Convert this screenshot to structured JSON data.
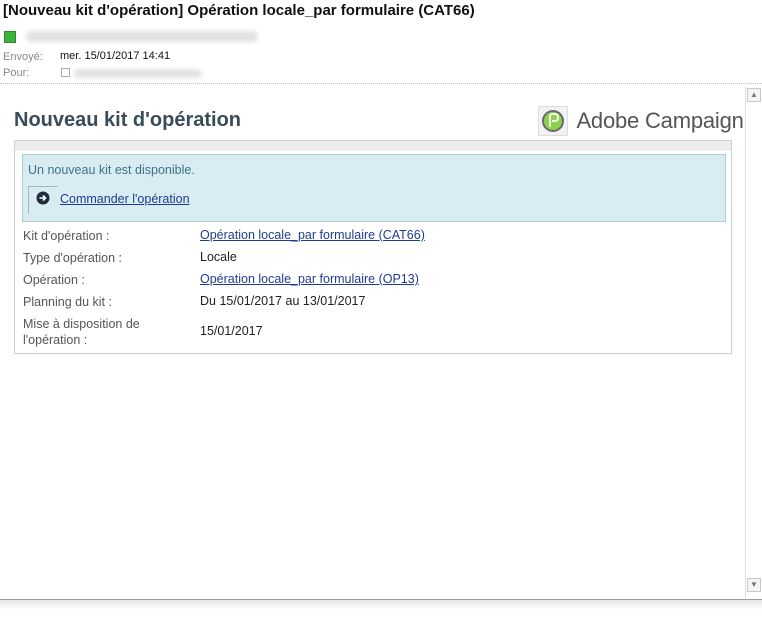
{
  "email": {
    "subject": "[Nouveau kit d'opération] Opération locale_par formulaire  (CAT66)",
    "sent_label": "Envoyé:",
    "sent_value": "mer. 15/01/2017 14:41",
    "to_label": "Pour:"
  },
  "content": {
    "title": "Nouveau kit d'opération",
    "logo_text": "Adobe Campaign",
    "notice": "Un nouveau kit est disponible.",
    "order_link": "Commander l'opération",
    "rows": [
      {
        "label": "Kit d'opération :",
        "value": "Opération locale_par formulaire (CAT66)"
      },
      {
        "label": "Type d'opération :",
        "value": "Locale"
      },
      {
        "label": "Opération :",
        "value": "Opération locale_par formulaire (OP13)"
      },
      {
        "label": "Planning du kit :",
        "value": "Du 15/01/2017 au 13/01/2017"
      },
      {
        "label": "Mise à disposition de l'opération :",
        "value": "15/01/2017"
      }
    ]
  },
  "icons": {
    "presence": "presence-status-icon",
    "logo": "adobe-campaign-logo-icon",
    "order": "arrow-right-circle-icon"
  },
  "colors": {
    "title": "#3a4c5a",
    "link": "#1f3d91",
    "notice_bg": "#d8ecf2",
    "notice_text": "#3d7488",
    "presence": "#3cb43c"
  }
}
